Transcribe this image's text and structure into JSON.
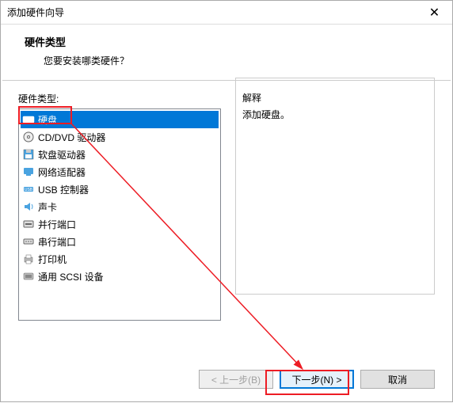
{
  "window": {
    "title": "添加硬件向导",
    "close": "✕"
  },
  "header": {
    "heading": "硬件类型",
    "subtitle": "您要安装哪类硬件？"
  },
  "left": {
    "label": "硬件类型:",
    "items": [
      {
        "label": "硬盘",
        "icon": "harddisk-icon",
        "color": "#1e90ff",
        "selected": true
      },
      {
        "label": "CD/DVD 驱动器",
        "icon": "cd-icon",
        "color": "#888",
        "selected": false
      },
      {
        "label": "软盘驱动器",
        "icon": "floppy-icon",
        "color": "#4aa3e0",
        "selected": false
      },
      {
        "label": "网络适配器",
        "icon": "network-icon",
        "color": "#4aa3e0",
        "selected": false
      },
      {
        "label": "USB 控制器",
        "icon": "usb-icon",
        "color": "#4aa3e0",
        "selected": false
      },
      {
        "label": "声卡",
        "icon": "sound-icon",
        "color": "#4aa3e0",
        "selected": false
      },
      {
        "label": "并行端口",
        "icon": "parallel-icon",
        "color": "#888",
        "selected": false
      },
      {
        "label": "串行端口",
        "icon": "serial-icon",
        "color": "#888",
        "selected": false
      },
      {
        "label": "打印机",
        "icon": "printer-icon",
        "color": "#888",
        "selected": false
      },
      {
        "label": "通用 SCSI 设备",
        "icon": "scsi-icon",
        "color": "#888",
        "selected": false
      }
    ]
  },
  "right": {
    "label": "解释",
    "description": "添加硬盘。"
  },
  "buttons": {
    "back": "< 上一步(B)",
    "next": "下一步(N) >",
    "cancel": "取消"
  }
}
